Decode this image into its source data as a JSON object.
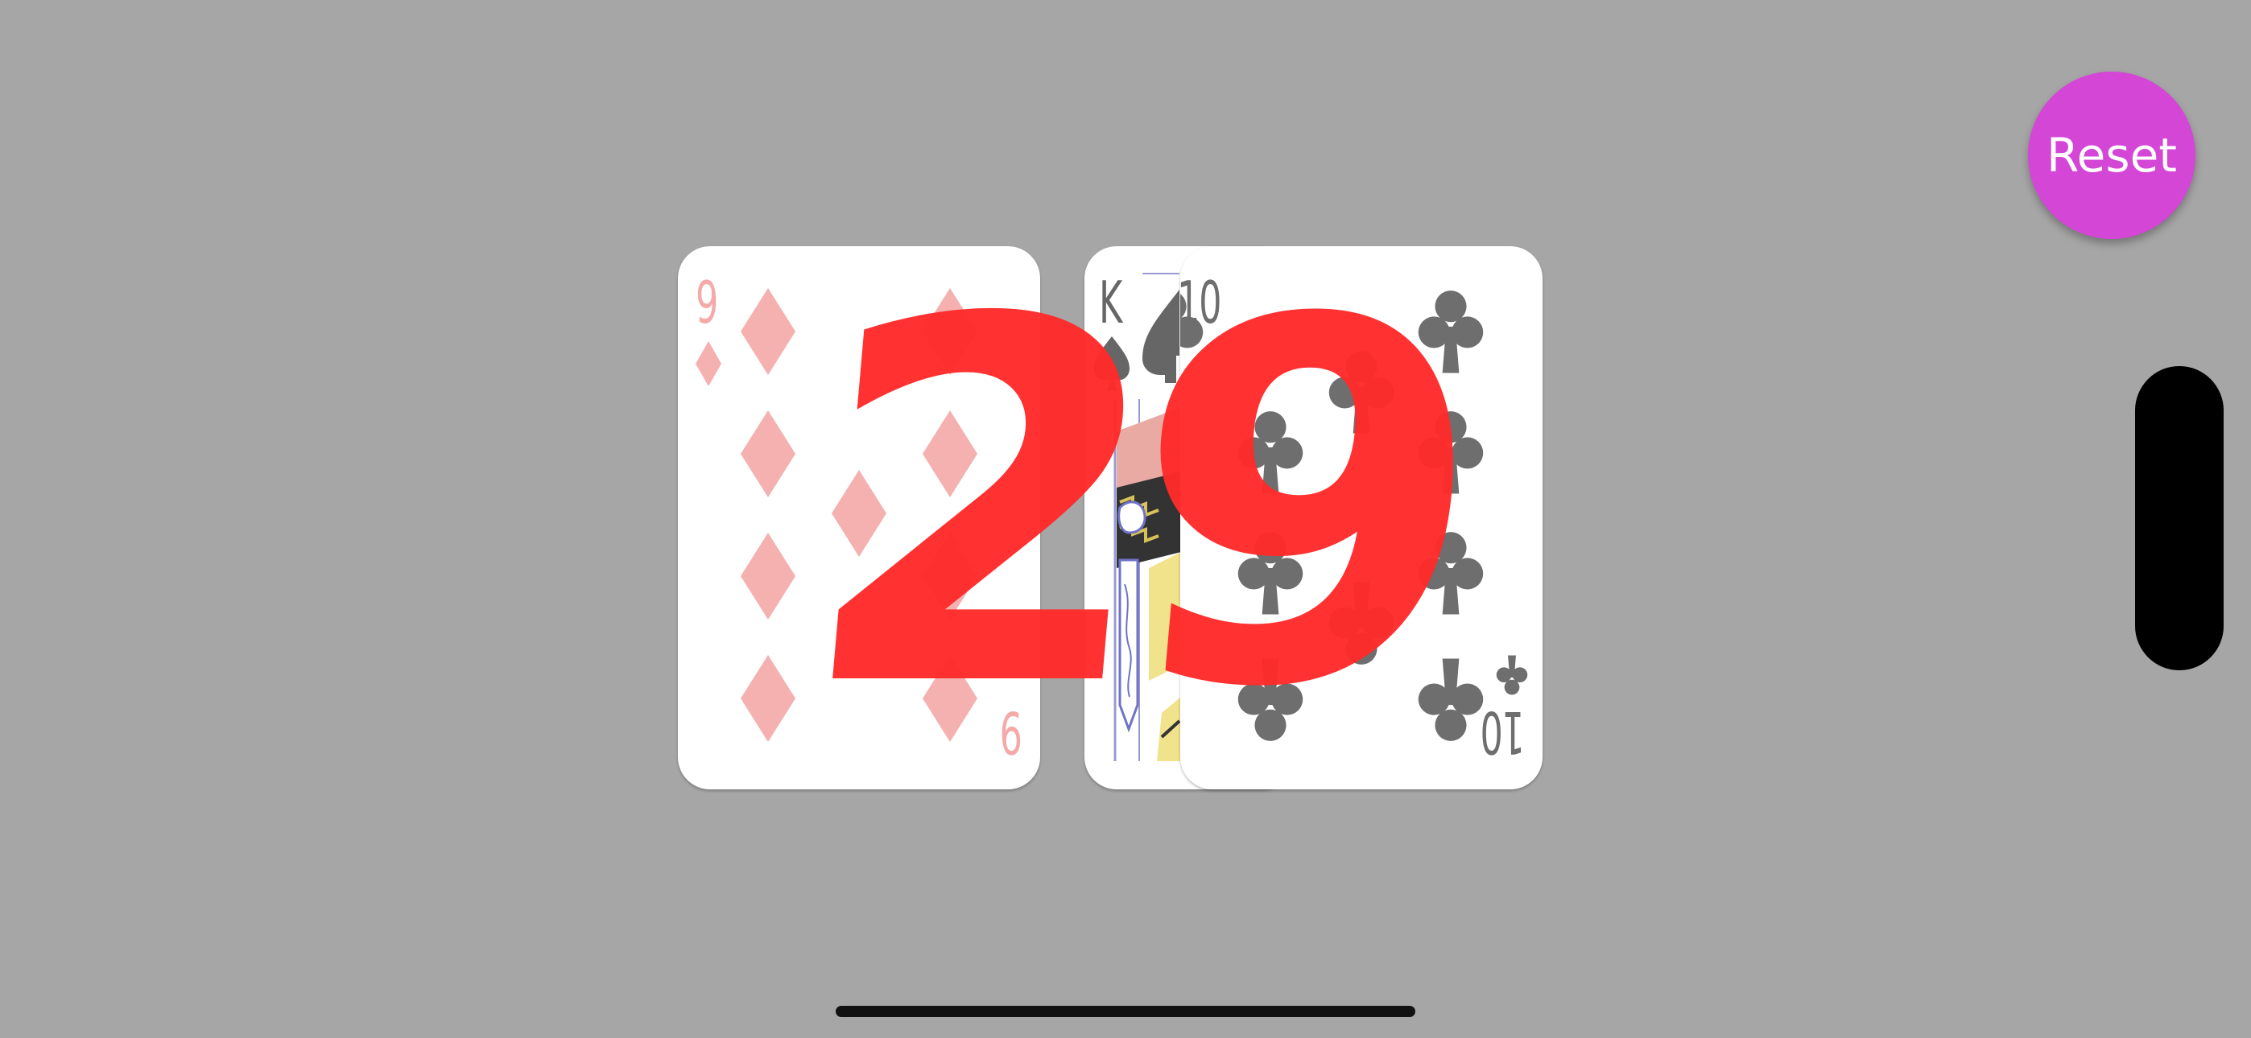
{
  "score": {
    "value": "29"
  },
  "reset_button": {
    "label": "Reset"
  },
  "cards": [
    {
      "rank": "9",
      "suit": "diamonds",
      "color": "#f5a9a9",
      "faded": true
    },
    {
      "rank": "K",
      "suit": "spades",
      "color": "#666666",
      "faded": false
    },
    {
      "rank": "10",
      "suit": "clubs",
      "color": "#6e6e6e",
      "faded": false
    }
  ],
  "colors": {
    "background": "#a6a6a6",
    "score": "#ff2b2b",
    "reset": "#d346d6"
  }
}
